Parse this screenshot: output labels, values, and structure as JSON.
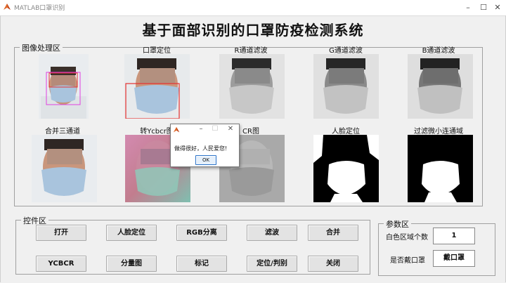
{
  "window": {
    "title": "MATLAB口罩识别"
  },
  "main_title": "基于面部识别的口罩防疫检测系统",
  "image_panel": {
    "label": "图像处理区",
    "images": [
      {
        "label": ""
      },
      {
        "label": "口罩定位"
      },
      {
        "label": "R通道滤波"
      },
      {
        "label": "G通道滤波"
      },
      {
        "label": "B通道滤波"
      },
      {
        "label": "合并三通道"
      },
      {
        "label": "转Ycbcr图"
      },
      {
        "label": "CR图"
      },
      {
        "label": "人脸定位"
      },
      {
        "label": "过滤微小连通域"
      }
    ]
  },
  "control_panel": {
    "label": "控件区",
    "buttons": [
      "打开",
      "人脸定位",
      "RGB分离",
      "滤波",
      "合并",
      "YCBCR",
      "分量图",
      "标记",
      "定位/判别",
      "关闭"
    ]
  },
  "param_panel": {
    "label": "参数区",
    "white_region_label": "白色区域个数",
    "white_region_value": "1",
    "mask_label": "是否戴口罩",
    "mask_value": "戴口罩"
  },
  "dialog": {
    "message": "做得很好，人民爱您!",
    "ok_label": "OK"
  },
  "colors": {
    "window_bg": "#f0f0f0",
    "red_box": "#e53030",
    "magenta_box": "#e040e0",
    "mask_blue": "#a9c4dd"
  }
}
